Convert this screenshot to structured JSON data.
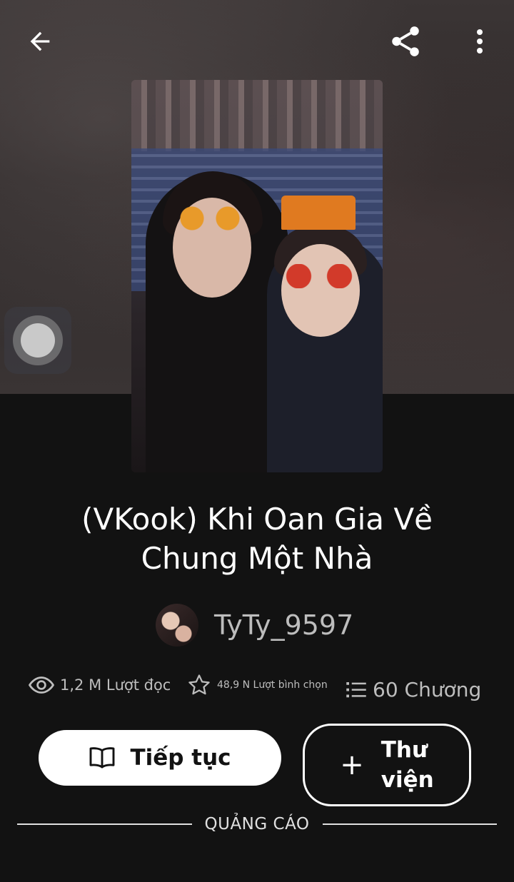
{
  "header": {
    "back_icon": "arrow-left-icon",
    "share_icon": "share-icon",
    "more_icon": "more-vertical-icon"
  },
  "story": {
    "title": "(VKook) Khi Oan Gia Về Chung Một Nhà",
    "author": "TyTy_9597",
    "stats": {
      "reads": "1,2 M Lượt đọc",
      "votes": "48,9 N Lượt bình chọn",
      "parts": "60 Chương"
    }
  },
  "actions": {
    "continue_label": "Tiếp tục",
    "library_label": "Thư viện"
  },
  "ad": {
    "label": "QUẢNG CÁO"
  },
  "colors": {
    "background": "#121212",
    "primary_button": "#ffffff",
    "muted_text": "#bdbdbd"
  }
}
